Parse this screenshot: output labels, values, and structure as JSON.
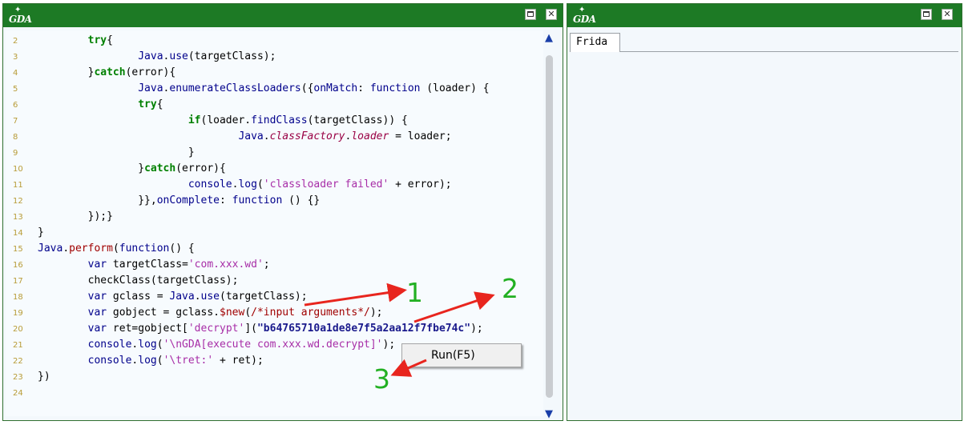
{
  "left_window": {
    "logo_text": "GDA",
    "lines": [
      {
        "no": "2",
        "html": "        <span class=\"kwb\">try</span>{"
      },
      {
        "no": "3",
        "html": "                <span class=\"kw\">Java</span>.<span class=\"kw\">use</span>(targetClass);"
      },
      {
        "no": "4",
        "html": "        }<span class=\"kwb\">catch</span>(error){"
      },
      {
        "no": "5",
        "html": "                <span class=\"kw\">Java</span>.<span class=\"kw\">enumerateClassLoaders</span>({<span class=\"kw\">onMatch</span>: <span class=\"kw\">function</span> (loader) {"
      },
      {
        "no": "6",
        "html": "                <span class=\"kwb\">try</span>{"
      },
      {
        "no": "7",
        "html": "                        <span class=\"kwb\">if</span>(loader.<span class=\"kw\">findClass</span>(targetClass)) {"
      },
      {
        "no": "8",
        "html": "                                <span class=\"kw\">Java</span>.<span class=\"it\">classFactory</span>.<span class=\"it\">loader</span> = loader;"
      },
      {
        "no": "9",
        "html": "                        }"
      },
      {
        "no": "10",
        "html": "                }<span class=\"kwb\">catch</span>(error){"
      },
      {
        "no": "11",
        "html": "                        <span class=\"kw\">console</span>.<span class=\"kw\">log</span>(<span class=\"str\">'classloader failed'</span> + error);"
      },
      {
        "no": "12",
        "html": "                }},<span class=\"kw\">onComplete</span>: <span class=\"kw\">function</span> () {}"
      },
      {
        "no": "13",
        "html": "        });}"
      },
      {
        "no": "14",
        "html": "}"
      },
      {
        "no": "15",
        "html": "<span class=\"kw\">Java</span>.<span class=\"cm\">perform</span>(<span class=\"kw\">function</span>() {"
      },
      {
        "no": "16",
        "html": "        <span class=\"kw\">var</span> targetClass=<span class=\"str\">'com.xxx.wd'</span>;"
      },
      {
        "no": "17",
        "html": "        checkClass(targetClass);"
      },
      {
        "no": "18",
        "html": "        <span class=\"kw\">var</span> gclass = <span class=\"kw\">Java</span>.<span class=\"kw\">use</span>(targetClass);"
      },
      {
        "no": "19",
        "html": "        <span class=\"kw\">var</span> gobject = gclass.<span class=\"cm\">$new</span>(<span class=\"cm\">/*input arguments*/</span>);"
      },
      {
        "no": "20",
        "html": "        <span class=\"kw\">var</span> ret=gobject[<span class=\"str\">'decrypt'</span>](<span class=\"lit\">\"b64765710a1de8e7f5a2aa12f7fbe74c\"</span>);"
      },
      {
        "no": "21",
        "html": "        <span class=\"kw\">console</span>.<span class=\"kw\">log</span>(<span class=\"str\">'\\nGDA[execute com.xxx.wd.decrypt]'</span>);"
      },
      {
        "no": "22",
        "html": "        <span class=\"kw\">console</span>.<span class=\"kw\">log</span>(<span class=\"str\">'\\tret:'</span> + ret);"
      },
      {
        "no": "23",
        "html": "})"
      },
      {
        "no": "24",
        "html": ""
      }
    ]
  },
  "right_window": {
    "logo_text": "GDA",
    "tab_label": "Frida"
  },
  "context_menu": {
    "item_label": "Run(F5)"
  },
  "annotations": {
    "one": "1",
    "two": "2",
    "three": "3"
  },
  "colors": {
    "titlebar": "#1d7a25",
    "annotation_arrow": "#e8251e",
    "annotation_number": "#22b022"
  }
}
